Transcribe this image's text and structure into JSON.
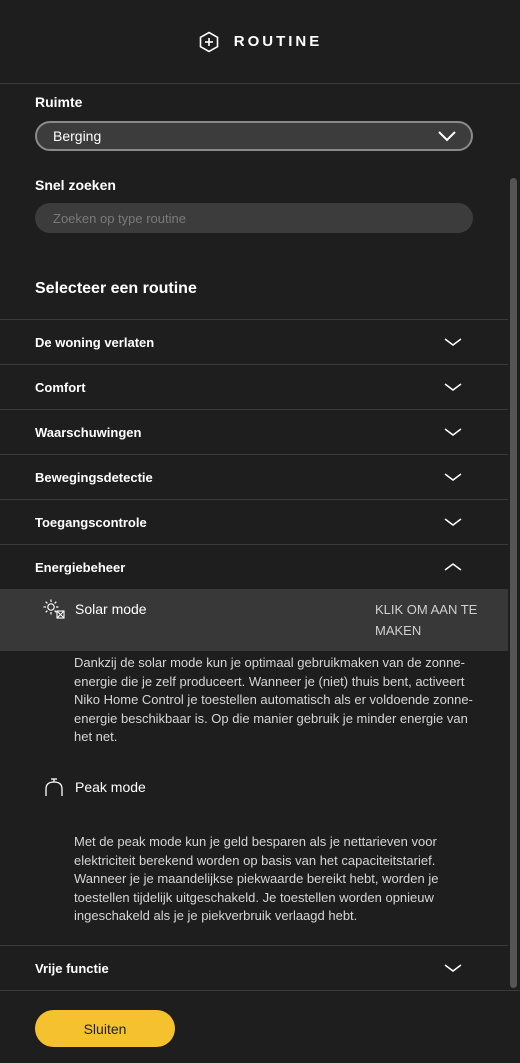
{
  "header": {
    "title": "ROUTINE",
    "icon": "plus-hexagon-icon"
  },
  "room": {
    "label": "Ruimte",
    "selected": "Berging"
  },
  "search": {
    "label": "Snel zoeken",
    "placeholder": "Zoeken op type routine",
    "value": ""
  },
  "select_routine_title": "Selecteer een routine",
  "categories": [
    {
      "label": "De woning verlaten",
      "expanded": false
    },
    {
      "label": "Comfort",
      "expanded": false
    },
    {
      "label": "Waarschuwingen",
      "expanded": false
    },
    {
      "label": "Bewegingsdetectie",
      "expanded": false
    },
    {
      "label": "Toegangscontrole",
      "expanded": false
    },
    {
      "label": "Energiebeheer",
      "expanded": true
    },
    {
      "label": "Vrije functie",
      "expanded": false
    }
  ],
  "routines": [
    {
      "name": "Solar mode",
      "icon": "solar-mode-icon",
      "action": "KLIK OM AAN TE MAKEN",
      "description": "Dankzij de solar mode kun je optimaal gebruikmaken van de zonne-energie die je zelf produceert. Wanneer je (niet) thuis bent, activeert Niko Home Control je toestellen automatisch als er voldoende zonne-energie beschikbaar is. Op die manier gebruik je minder energie van het net."
    },
    {
      "name": "Peak mode",
      "icon": "peak-mode-icon",
      "description": "Met de peak mode kun je geld besparen als je nettarieven voor elektriciteit berekend worden op basis van het capaciteitstarief. Wanneer je je maandelijkse piekwaarde bereikt hebt, worden je toestellen tijdelijk uitgeschakeld. Je toestellen worden opnieuw ingeschakeld als je je piekverbruik verlaagd hebt."
    }
  ],
  "footer": {
    "close_label": "Sluiten"
  },
  "colors": {
    "background": "#1e1e1e",
    "accent": "#f5c12e",
    "input_bg": "#3c3c3c",
    "selected_row": "#383838"
  }
}
